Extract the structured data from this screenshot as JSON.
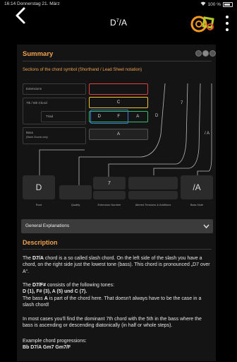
{
  "status": {
    "time": "16:14",
    "date": "Donnerstag 21. März",
    "battery": "100 %"
  },
  "header": {
    "title_root": "D",
    "title_sup": "7",
    "title_bass": "/A"
  },
  "summary": {
    "heading": "Summary",
    "sections_title": "Sections of the chord symbol (Shorthand / Lead Sheet notation)",
    "labels": {
      "extensions": "Extensions",
      "seventh": "7th / 6th Chord",
      "triad": "Triad",
      "bass": "Bass",
      "bass_sub": "(Slash Chords only)"
    },
    "boxes": {
      "seventh": "C",
      "triad_notes": [
        "D",
        "F",
        "A"
      ],
      "triad_extra": "D",
      "bass": "A",
      "seven_mark": "7",
      "slash_mark": "/ A"
    },
    "symbol": [
      {
        "value": "D",
        "label": "Root"
      },
      {
        "value": "",
        "label": "Quality"
      },
      {
        "value": "7",
        "label": "Extension Number"
      },
      {
        "value": "",
        "label": "Altered Tensions & Additions"
      },
      {
        "value": "/A",
        "label": "Bass Note"
      }
    ]
  },
  "general": {
    "label": "General Explanations"
  },
  "description": {
    "heading": "Description",
    "p1_a": "The ",
    "p1_b": "D7/A",
    "p1_c": " chord is a so called slash chord. On the left side of the slash you have a chord, on the right side just the lowest tone (bass). This chord is pronounced „D7 over A“.",
    "p2_a": "The ",
    "p2_b": "D7/F#",
    "p2_c": " consists of the following tones:",
    "p3": "D (1), F# (3), A (5) und C (7).",
    "p4_a": "The bass ",
    "p4_b": "A",
    "p4_c": " is part of the chord here. That doesn't always have to be the case in a slash chord!",
    "p5": "In most cases you'll find the dominant 7th chord with the 5th in the bass where the bass is ascending or descending diatonically (in half or whole steps).",
    "p6": "Example chord progressions:",
    "p7": "Bb  D7/A  Gm7  Gm7/F"
  },
  "colors": {
    "accent": "#f0a24e",
    "red": "#e04040",
    "yellow": "#f2c12e",
    "green": "#2fbf6d",
    "blue": "#3a7bd5"
  }
}
